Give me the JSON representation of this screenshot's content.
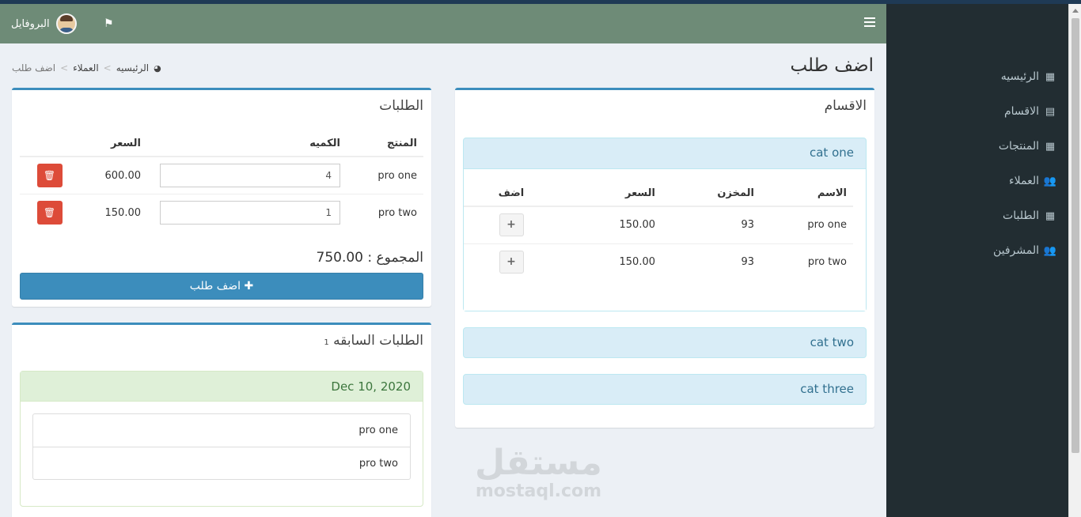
{
  "header": {
    "profile_name": "البروفايل",
    "flag_icon": "flag-icon",
    "menu_icon": "hamburger-icon"
  },
  "sidebar": {
    "items": [
      {
        "label": "الرئيسيه",
        "icon": "grid-icon",
        "glyph": "▦"
      },
      {
        "label": "الاقسام",
        "icon": "book-icon",
        "glyph": "▤"
      },
      {
        "label": "المنتجات",
        "icon": "grid-icon",
        "glyph": "▦"
      },
      {
        "label": "العملاء",
        "icon": "users-icon",
        "glyph": "👥"
      },
      {
        "label": "الطلبات",
        "icon": "grid-icon",
        "glyph": "▦"
      },
      {
        "label": "المشرفين",
        "icon": "users-icon",
        "glyph": "👥"
      }
    ]
  },
  "page": {
    "title": "اضف طلب",
    "breadcrumb": {
      "home": "الرئيسيه",
      "clients": "العملاء",
      "current": "اضف طلب"
    }
  },
  "categories": {
    "title": "الاقسام",
    "open": {
      "name": "cat one",
      "headers": {
        "name": "الاسم",
        "stock": "المخزن",
        "price": "السعر",
        "add": "اضف"
      },
      "rows": [
        {
          "name": "pro one",
          "stock": "93",
          "price": "150.00",
          "add": "+"
        },
        {
          "name": "pro two",
          "stock": "93",
          "price": "150.00",
          "add": "+"
        }
      ]
    },
    "closed": [
      "cat two",
      "cat three"
    ]
  },
  "orders": {
    "title": "الطلبات",
    "headers": {
      "product": "المنتج",
      "quantity": "الكميه",
      "price": "السعر"
    },
    "rows": [
      {
        "product": "pro one",
        "quantity": "4",
        "price": "600.00"
      },
      {
        "product": "pro two",
        "quantity": "1",
        "price": "150.00"
      }
    ],
    "total_label": "المجموع : 750.00",
    "add_button": "اضف طلب"
  },
  "previous": {
    "title": "الطلبات السابقه",
    "count": "1",
    "date": "Dec 10, 2020",
    "items": [
      "pro one",
      "pro two"
    ]
  },
  "watermark": {
    "arabic": "مستقل",
    "latin": "mostaql.com"
  }
}
